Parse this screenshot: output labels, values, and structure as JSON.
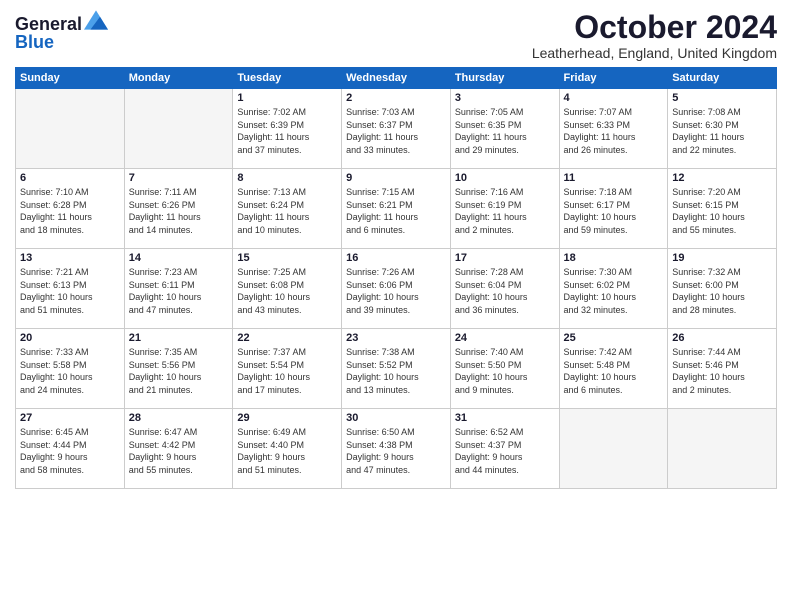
{
  "header": {
    "logo_line1": "General",
    "logo_line2": "Blue",
    "month": "October 2024",
    "location": "Leatherhead, England, United Kingdom"
  },
  "weekdays": [
    "Sunday",
    "Monday",
    "Tuesday",
    "Wednesday",
    "Thursday",
    "Friday",
    "Saturday"
  ],
  "weeks": [
    [
      {
        "day": "",
        "info": ""
      },
      {
        "day": "",
        "info": ""
      },
      {
        "day": "1",
        "info": "Sunrise: 7:02 AM\nSunset: 6:39 PM\nDaylight: 11 hours\nand 37 minutes."
      },
      {
        "day": "2",
        "info": "Sunrise: 7:03 AM\nSunset: 6:37 PM\nDaylight: 11 hours\nand 33 minutes."
      },
      {
        "day": "3",
        "info": "Sunrise: 7:05 AM\nSunset: 6:35 PM\nDaylight: 11 hours\nand 29 minutes."
      },
      {
        "day": "4",
        "info": "Sunrise: 7:07 AM\nSunset: 6:33 PM\nDaylight: 11 hours\nand 26 minutes."
      },
      {
        "day": "5",
        "info": "Sunrise: 7:08 AM\nSunset: 6:30 PM\nDaylight: 11 hours\nand 22 minutes."
      }
    ],
    [
      {
        "day": "6",
        "info": "Sunrise: 7:10 AM\nSunset: 6:28 PM\nDaylight: 11 hours\nand 18 minutes."
      },
      {
        "day": "7",
        "info": "Sunrise: 7:11 AM\nSunset: 6:26 PM\nDaylight: 11 hours\nand 14 minutes."
      },
      {
        "day": "8",
        "info": "Sunrise: 7:13 AM\nSunset: 6:24 PM\nDaylight: 11 hours\nand 10 minutes."
      },
      {
        "day": "9",
        "info": "Sunrise: 7:15 AM\nSunset: 6:21 PM\nDaylight: 11 hours\nand 6 minutes."
      },
      {
        "day": "10",
        "info": "Sunrise: 7:16 AM\nSunset: 6:19 PM\nDaylight: 11 hours\nand 2 minutes."
      },
      {
        "day": "11",
        "info": "Sunrise: 7:18 AM\nSunset: 6:17 PM\nDaylight: 10 hours\nand 59 minutes."
      },
      {
        "day": "12",
        "info": "Sunrise: 7:20 AM\nSunset: 6:15 PM\nDaylight: 10 hours\nand 55 minutes."
      }
    ],
    [
      {
        "day": "13",
        "info": "Sunrise: 7:21 AM\nSunset: 6:13 PM\nDaylight: 10 hours\nand 51 minutes."
      },
      {
        "day": "14",
        "info": "Sunrise: 7:23 AM\nSunset: 6:11 PM\nDaylight: 10 hours\nand 47 minutes."
      },
      {
        "day": "15",
        "info": "Sunrise: 7:25 AM\nSunset: 6:08 PM\nDaylight: 10 hours\nand 43 minutes."
      },
      {
        "day": "16",
        "info": "Sunrise: 7:26 AM\nSunset: 6:06 PM\nDaylight: 10 hours\nand 39 minutes."
      },
      {
        "day": "17",
        "info": "Sunrise: 7:28 AM\nSunset: 6:04 PM\nDaylight: 10 hours\nand 36 minutes."
      },
      {
        "day": "18",
        "info": "Sunrise: 7:30 AM\nSunset: 6:02 PM\nDaylight: 10 hours\nand 32 minutes."
      },
      {
        "day": "19",
        "info": "Sunrise: 7:32 AM\nSunset: 6:00 PM\nDaylight: 10 hours\nand 28 minutes."
      }
    ],
    [
      {
        "day": "20",
        "info": "Sunrise: 7:33 AM\nSunset: 5:58 PM\nDaylight: 10 hours\nand 24 minutes."
      },
      {
        "day": "21",
        "info": "Sunrise: 7:35 AM\nSunset: 5:56 PM\nDaylight: 10 hours\nand 21 minutes."
      },
      {
        "day": "22",
        "info": "Sunrise: 7:37 AM\nSunset: 5:54 PM\nDaylight: 10 hours\nand 17 minutes."
      },
      {
        "day": "23",
        "info": "Sunrise: 7:38 AM\nSunset: 5:52 PM\nDaylight: 10 hours\nand 13 minutes."
      },
      {
        "day": "24",
        "info": "Sunrise: 7:40 AM\nSunset: 5:50 PM\nDaylight: 10 hours\nand 9 minutes."
      },
      {
        "day": "25",
        "info": "Sunrise: 7:42 AM\nSunset: 5:48 PM\nDaylight: 10 hours\nand 6 minutes."
      },
      {
        "day": "26",
        "info": "Sunrise: 7:44 AM\nSunset: 5:46 PM\nDaylight: 10 hours\nand 2 minutes."
      }
    ],
    [
      {
        "day": "27",
        "info": "Sunrise: 6:45 AM\nSunset: 4:44 PM\nDaylight: 9 hours\nand 58 minutes."
      },
      {
        "day": "28",
        "info": "Sunrise: 6:47 AM\nSunset: 4:42 PM\nDaylight: 9 hours\nand 55 minutes."
      },
      {
        "day": "29",
        "info": "Sunrise: 6:49 AM\nSunset: 4:40 PM\nDaylight: 9 hours\nand 51 minutes."
      },
      {
        "day": "30",
        "info": "Sunrise: 6:50 AM\nSunset: 4:38 PM\nDaylight: 9 hours\nand 47 minutes."
      },
      {
        "day": "31",
        "info": "Sunrise: 6:52 AM\nSunset: 4:37 PM\nDaylight: 9 hours\nand 44 minutes."
      },
      {
        "day": "",
        "info": ""
      },
      {
        "day": "",
        "info": ""
      }
    ]
  ]
}
